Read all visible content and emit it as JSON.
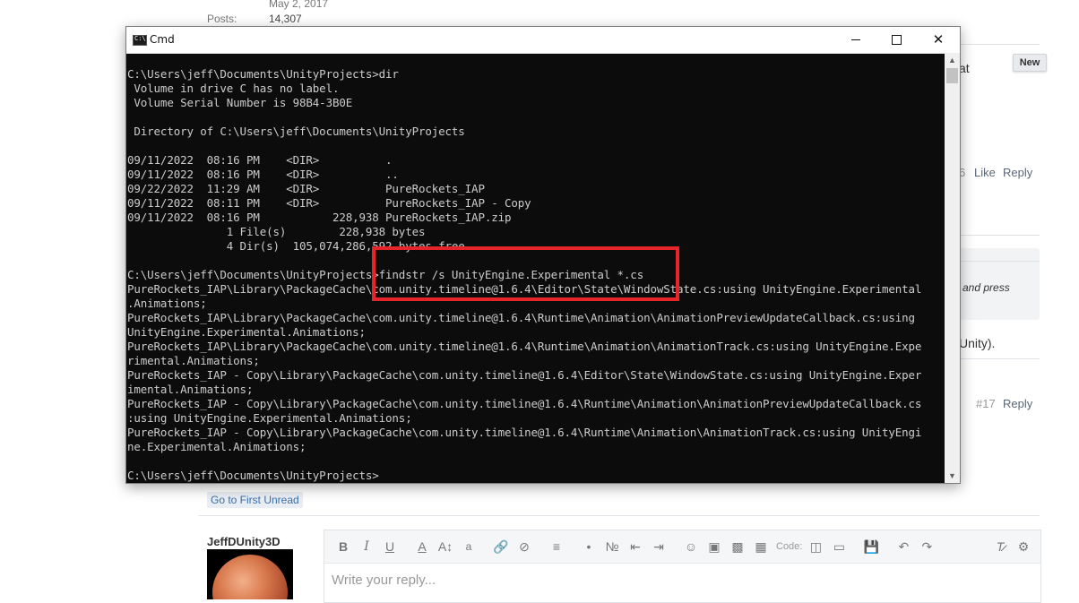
{
  "forum": {
    "join_date": "May 2, 2017",
    "posts_label": "Posts:",
    "posts_count": "14,307",
    "new_badge": "New",
    "partial_at": "at",
    "post_number_6": "6",
    "like_label": "Like",
    "reply_label": "Reply",
    "partial_and_press": "and press",
    "partial_unity": "Unity).",
    "post_number_17": "#17",
    "reply_label_2": "Reply",
    "go_first_unread": "Go to First Unread",
    "username": "JeffDUnity3D",
    "toolbar_code_label": "Code:",
    "reply_placeholder": "Write your reply..."
  },
  "cmd": {
    "title": "Cmd",
    "lines": [
      "C:\\Users\\jeff\\Documents\\UnityProjects>dir",
      " Volume in drive C has no label.",
      " Volume Serial Number is 98B4-3B0E",
      "",
      " Directory of C:\\Users\\jeff\\Documents\\UnityProjects",
      "",
      "09/11/2022  08:16 PM    <DIR>          .",
      "09/11/2022  08:16 PM    <DIR>          ..",
      "09/22/2022  11:29 AM    <DIR>          PureRockets_IAP",
      "09/11/2022  08:11 PM    <DIR>          PureRockets_IAP - Copy",
      "09/11/2022  08:16 PM           228,938 PureRockets_IAP.zip",
      "               1 File(s)        228,938 bytes",
      "               4 Dir(s)  105,074,286,592 bytes free",
      "",
      "C:\\Users\\jeff\\Documents\\UnityProjects>findstr /s UnityEngine.Experimental *.cs",
      "PureRockets_IAP\\Library\\PackageCache\\com.unity.timeline@1.6.4\\Editor\\State\\WindowState.cs:using UnityEngine.Experimental",
      ".Animations;",
      "PureRockets_IAP\\Library\\PackageCache\\com.unity.timeline@1.6.4\\Runtime\\Animation\\AnimationPreviewUpdateCallback.cs:using",
      "UnityEngine.Experimental.Animations;",
      "PureRockets_IAP\\Library\\PackageCache\\com.unity.timeline@1.6.4\\Runtime\\Animation\\AnimationTrack.cs:using UnityEngine.Expe",
      "rimental.Animations;",
      "PureRockets_IAP - Copy\\Library\\PackageCache\\com.unity.timeline@1.6.4\\Editor\\State\\WindowState.cs:using UnityEngine.Exper",
      "imental.Animations;",
      "PureRockets_IAP - Copy\\Library\\PackageCache\\com.unity.timeline@1.6.4\\Runtime\\Animation\\AnimationPreviewUpdateCallback.cs",
      ":using UnityEngine.Experimental.Animations;",
      "PureRockets_IAP - Copy\\Library\\PackageCache\\com.unity.timeline@1.6.4\\Runtime\\Animation\\AnimationTrack.cs:using UnityEngi",
      "ne.Experimental.Animations;",
      "",
      "C:\\Users\\jeff\\Documents\\UnityProjects>"
    ]
  },
  "colors": {
    "highlight": "#e8242b",
    "console_bg": "#0c0c0c",
    "console_text": "#cccccc"
  }
}
